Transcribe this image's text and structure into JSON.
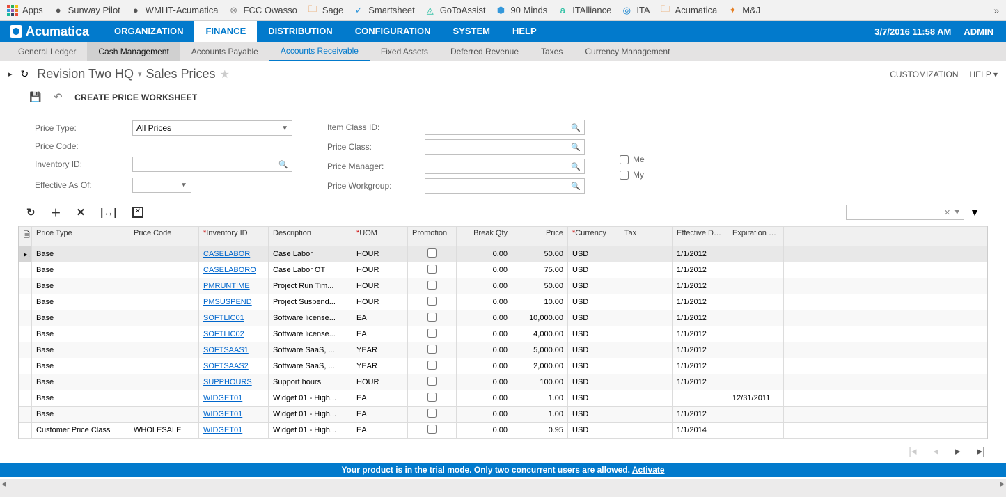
{
  "browser": {
    "apps": "Apps",
    "bookmarks": [
      "Sunway Pilot",
      "WMHT-Acumatica",
      "FCC Owasso",
      "Sage",
      "Smartsheet",
      "GoToAssist",
      "90 Minds",
      "ITAlliance",
      "ITA",
      "Acumatica",
      "M&J"
    ]
  },
  "nav": {
    "brand": "Acumatica",
    "items": [
      "ORGANIZATION",
      "FINANCE",
      "DISTRIBUTION",
      "CONFIGURATION",
      "SYSTEM",
      "HELP"
    ],
    "active": "FINANCE",
    "datetime": "3/7/2016  11:58 AM",
    "user": "ADMIN"
  },
  "subnav": {
    "items": [
      "General Ledger",
      "Cash Management",
      "Accounts Payable",
      "Accounts Receivable",
      "Fixed Assets",
      "Deferred Revenue",
      "Taxes",
      "Currency Management"
    ],
    "selected": "Cash Management",
    "active": "Accounts Receivable"
  },
  "page": {
    "org": "Revision Two HQ",
    "title": "Sales Prices",
    "customization": "CUSTOMIZATION",
    "help": "HELP"
  },
  "toolbar": {
    "create": "CREATE PRICE WORKSHEET"
  },
  "form": {
    "priceType": {
      "label": "Price Type:",
      "value": "All Prices"
    },
    "priceCode": {
      "label": "Price Code:"
    },
    "inventoryId": {
      "label": "Inventory ID:"
    },
    "effectiveAsOf": {
      "label": "Effective As Of:"
    },
    "itemClassId": {
      "label": "Item Class ID:"
    },
    "priceClass": {
      "label": "Price Class:"
    },
    "priceManager": {
      "label": "Price Manager:"
    },
    "priceWorkgroup": {
      "label": "Price Workgroup:"
    },
    "me": "Me",
    "my": "My"
  },
  "grid": {
    "headers": {
      "priceType": "Price Type",
      "priceCode": "Price Code",
      "inventoryId": "Inventory ID",
      "description": "Description",
      "uom": "UOM",
      "promotion": "Promotion",
      "breakQty": "Break Qty",
      "price": "Price",
      "currency": "Currency",
      "tax": "Tax",
      "effectiveDate": "Effective Date",
      "expirationDate": "Expiration Date"
    },
    "rows": [
      {
        "priceType": "Base",
        "priceCode": "",
        "inventoryId": "CASELABOR",
        "description": "Case Labor",
        "uom": "HOUR",
        "promotion": false,
        "breakQty": "0.00",
        "price": "50.00",
        "currency": "USD",
        "tax": "",
        "effectiveDate": "1/1/2012",
        "expirationDate": ""
      },
      {
        "priceType": "Base",
        "priceCode": "",
        "inventoryId": "CASELABORO",
        "description": "Case Labor OT",
        "uom": "HOUR",
        "promotion": false,
        "breakQty": "0.00",
        "price": "75.00",
        "currency": "USD",
        "tax": "",
        "effectiveDate": "1/1/2012",
        "expirationDate": ""
      },
      {
        "priceType": "Base",
        "priceCode": "",
        "inventoryId": "PMRUNTIME",
        "description": "Project Run Tim...",
        "uom": "HOUR",
        "promotion": false,
        "breakQty": "0.00",
        "price": "50.00",
        "currency": "USD",
        "tax": "",
        "effectiveDate": "1/1/2012",
        "expirationDate": ""
      },
      {
        "priceType": "Base",
        "priceCode": "",
        "inventoryId": "PMSUSPEND",
        "description": "Project Suspend...",
        "uom": "HOUR",
        "promotion": false,
        "breakQty": "0.00",
        "price": "10.00",
        "currency": "USD",
        "tax": "",
        "effectiveDate": "1/1/2012",
        "expirationDate": ""
      },
      {
        "priceType": "Base",
        "priceCode": "",
        "inventoryId": "SOFTLIC01",
        "description": "Software license...",
        "uom": "EA",
        "promotion": false,
        "breakQty": "0.00",
        "price": "10,000.00",
        "currency": "USD",
        "tax": "",
        "effectiveDate": "1/1/2012",
        "expirationDate": ""
      },
      {
        "priceType": "Base",
        "priceCode": "",
        "inventoryId": "SOFTLIC02",
        "description": "Software license...",
        "uom": "EA",
        "promotion": false,
        "breakQty": "0.00",
        "price": "4,000.00",
        "currency": "USD",
        "tax": "",
        "effectiveDate": "1/1/2012",
        "expirationDate": ""
      },
      {
        "priceType": "Base",
        "priceCode": "",
        "inventoryId": "SOFTSAAS1",
        "description": "Software SaaS, ...",
        "uom": "YEAR",
        "promotion": false,
        "breakQty": "0.00",
        "price": "5,000.00",
        "currency": "USD",
        "tax": "",
        "effectiveDate": "1/1/2012",
        "expirationDate": ""
      },
      {
        "priceType": "Base",
        "priceCode": "",
        "inventoryId": "SOFTSAAS2",
        "description": "Software SaaS, ...",
        "uom": "YEAR",
        "promotion": false,
        "breakQty": "0.00",
        "price": "2,000.00",
        "currency": "USD",
        "tax": "",
        "effectiveDate": "1/1/2012",
        "expirationDate": ""
      },
      {
        "priceType": "Base",
        "priceCode": "",
        "inventoryId": "SUPPHOURS",
        "description": "Support hours",
        "uom": "HOUR",
        "promotion": false,
        "breakQty": "0.00",
        "price": "100.00",
        "currency": "USD",
        "tax": "",
        "effectiveDate": "1/1/2012",
        "expirationDate": ""
      },
      {
        "priceType": "Base",
        "priceCode": "",
        "inventoryId": "WIDGET01",
        "description": "Widget 01 - High...",
        "uom": "EA",
        "promotion": false,
        "breakQty": "0.00",
        "price": "1.00",
        "currency": "USD",
        "tax": "",
        "effectiveDate": "",
        "expirationDate": "12/31/2011"
      },
      {
        "priceType": "Base",
        "priceCode": "",
        "inventoryId": "WIDGET01",
        "description": "Widget 01 - High...",
        "uom": "EA",
        "promotion": false,
        "breakQty": "0.00",
        "price": "1.00",
        "currency": "USD",
        "tax": "",
        "effectiveDate": "1/1/2012",
        "expirationDate": ""
      },
      {
        "priceType": "Customer Price Class",
        "priceCode": "WHOLESALE",
        "inventoryId": "WIDGET01",
        "description": "Widget 01 - High...",
        "uom": "EA",
        "promotion": false,
        "breakQty": "0.00",
        "price": "0.95",
        "currency": "USD",
        "tax": "",
        "effectiveDate": "1/1/2014",
        "expirationDate": ""
      }
    ]
  },
  "footer": {
    "trial": "Your product is in the trial mode. Only two concurrent users are allowed.",
    "activate": "Activate"
  }
}
